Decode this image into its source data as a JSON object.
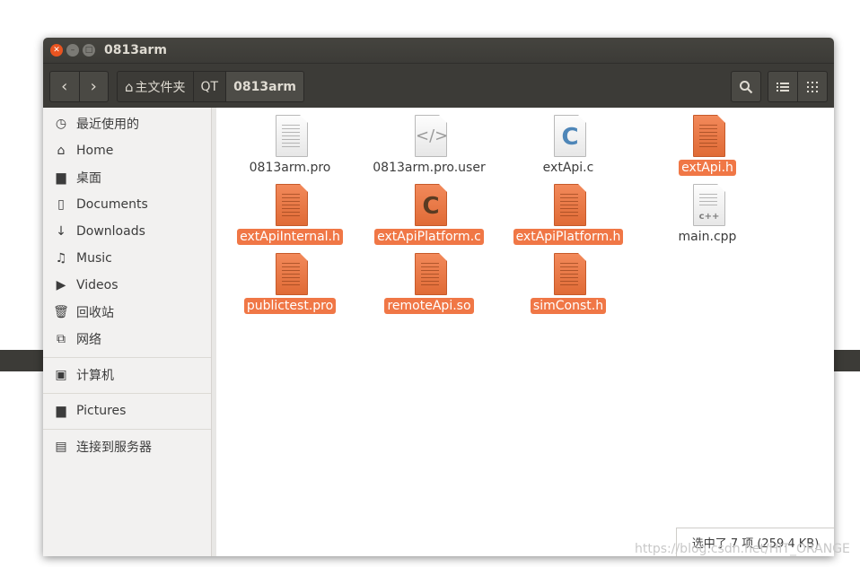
{
  "window": {
    "title": "0813arm"
  },
  "toolbar": {
    "back_glyph": "‹",
    "forward_glyph": "›",
    "breadcrumbs": [
      {
        "label": "主文件夹",
        "icon": "home-icon"
      },
      {
        "label": "QT"
      },
      {
        "label": "0813arm",
        "active": true
      }
    ],
    "search_icon": "search-icon",
    "list_view_icon": "list-view-icon",
    "grid_view_icon": "grid-view-icon"
  },
  "sidebar": {
    "items": [
      {
        "label": "最近使用的",
        "icon": "recent-icon"
      },
      {
        "label": "Home",
        "icon": "home-icon"
      },
      {
        "label": "桌面",
        "icon": "desktop-icon"
      },
      {
        "label": "Documents",
        "icon": "document-icon"
      },
      {
        "label": "Downloads",
        "icon": "download-icon"
      },
      {
        "label": "Music",
        "icon": "music-icon"
      },
      {
        "label": "Videos",
        "icon": "video-icon"
      },
      {
        "label": "回收站",
        "icon": "trash-icon"
      },
      {
        "label": "网络",
        "icon": "network-icon"
      },
      {
        "label": "计算机",
        "icon": "computer-icon"
      },
      {
        "label": "Pictures",
        "icon": "folder-icon"
      },
      {
        "label": "连接到服务器",
        "icon": "server-icon"
      }
    ]
  },
  "files": [
    {
      "name": "0813arm.pro",
      "type": "text",
      "selected": false
    },
    {
      "name": "0813arm.pro.user",
      "type": "code",
      "selected": false
    },
    {
      "name": "extApi.c",
      "type": "c-source",
      "selected": false
    },
    {
      "name": "extApi.h",
      "type": "header",
      "selected": true
    },
    {
      "name": "extApiInternal.h",
      "type": "header",
      "selected": true
    },
    {
      "name": "extApiPlatform.c",
      "type": "c-source",
      "selected": true
    },
    {
      "name": "extApiPlatform.h",
      "type": "header",
      "selected": true
    },
    {
      "name": "main.cpp",
      "type": "cpp-source",
      "selected": false
    },
    {
      "name": "publictest.pro",
      "type": "text",
      "selected": true
    },
    {
      "name": "remoteApi.so",
      "type": "library",
      "selected": true
    },
    {
      "name": "simConst.h",
      "type": "header",
      "selected": true
    }
  ],
  "status": {
    "text": "选中了 7 项 (259.4 KB)"
  },
  "watermark": "https://blog.csdn.net/HIT_ORANGE",
  "colors": {
    "titlebar": "#3c3b37",
    "selection": "#f07746",
    "close_button": "#e95420"
  }
}
